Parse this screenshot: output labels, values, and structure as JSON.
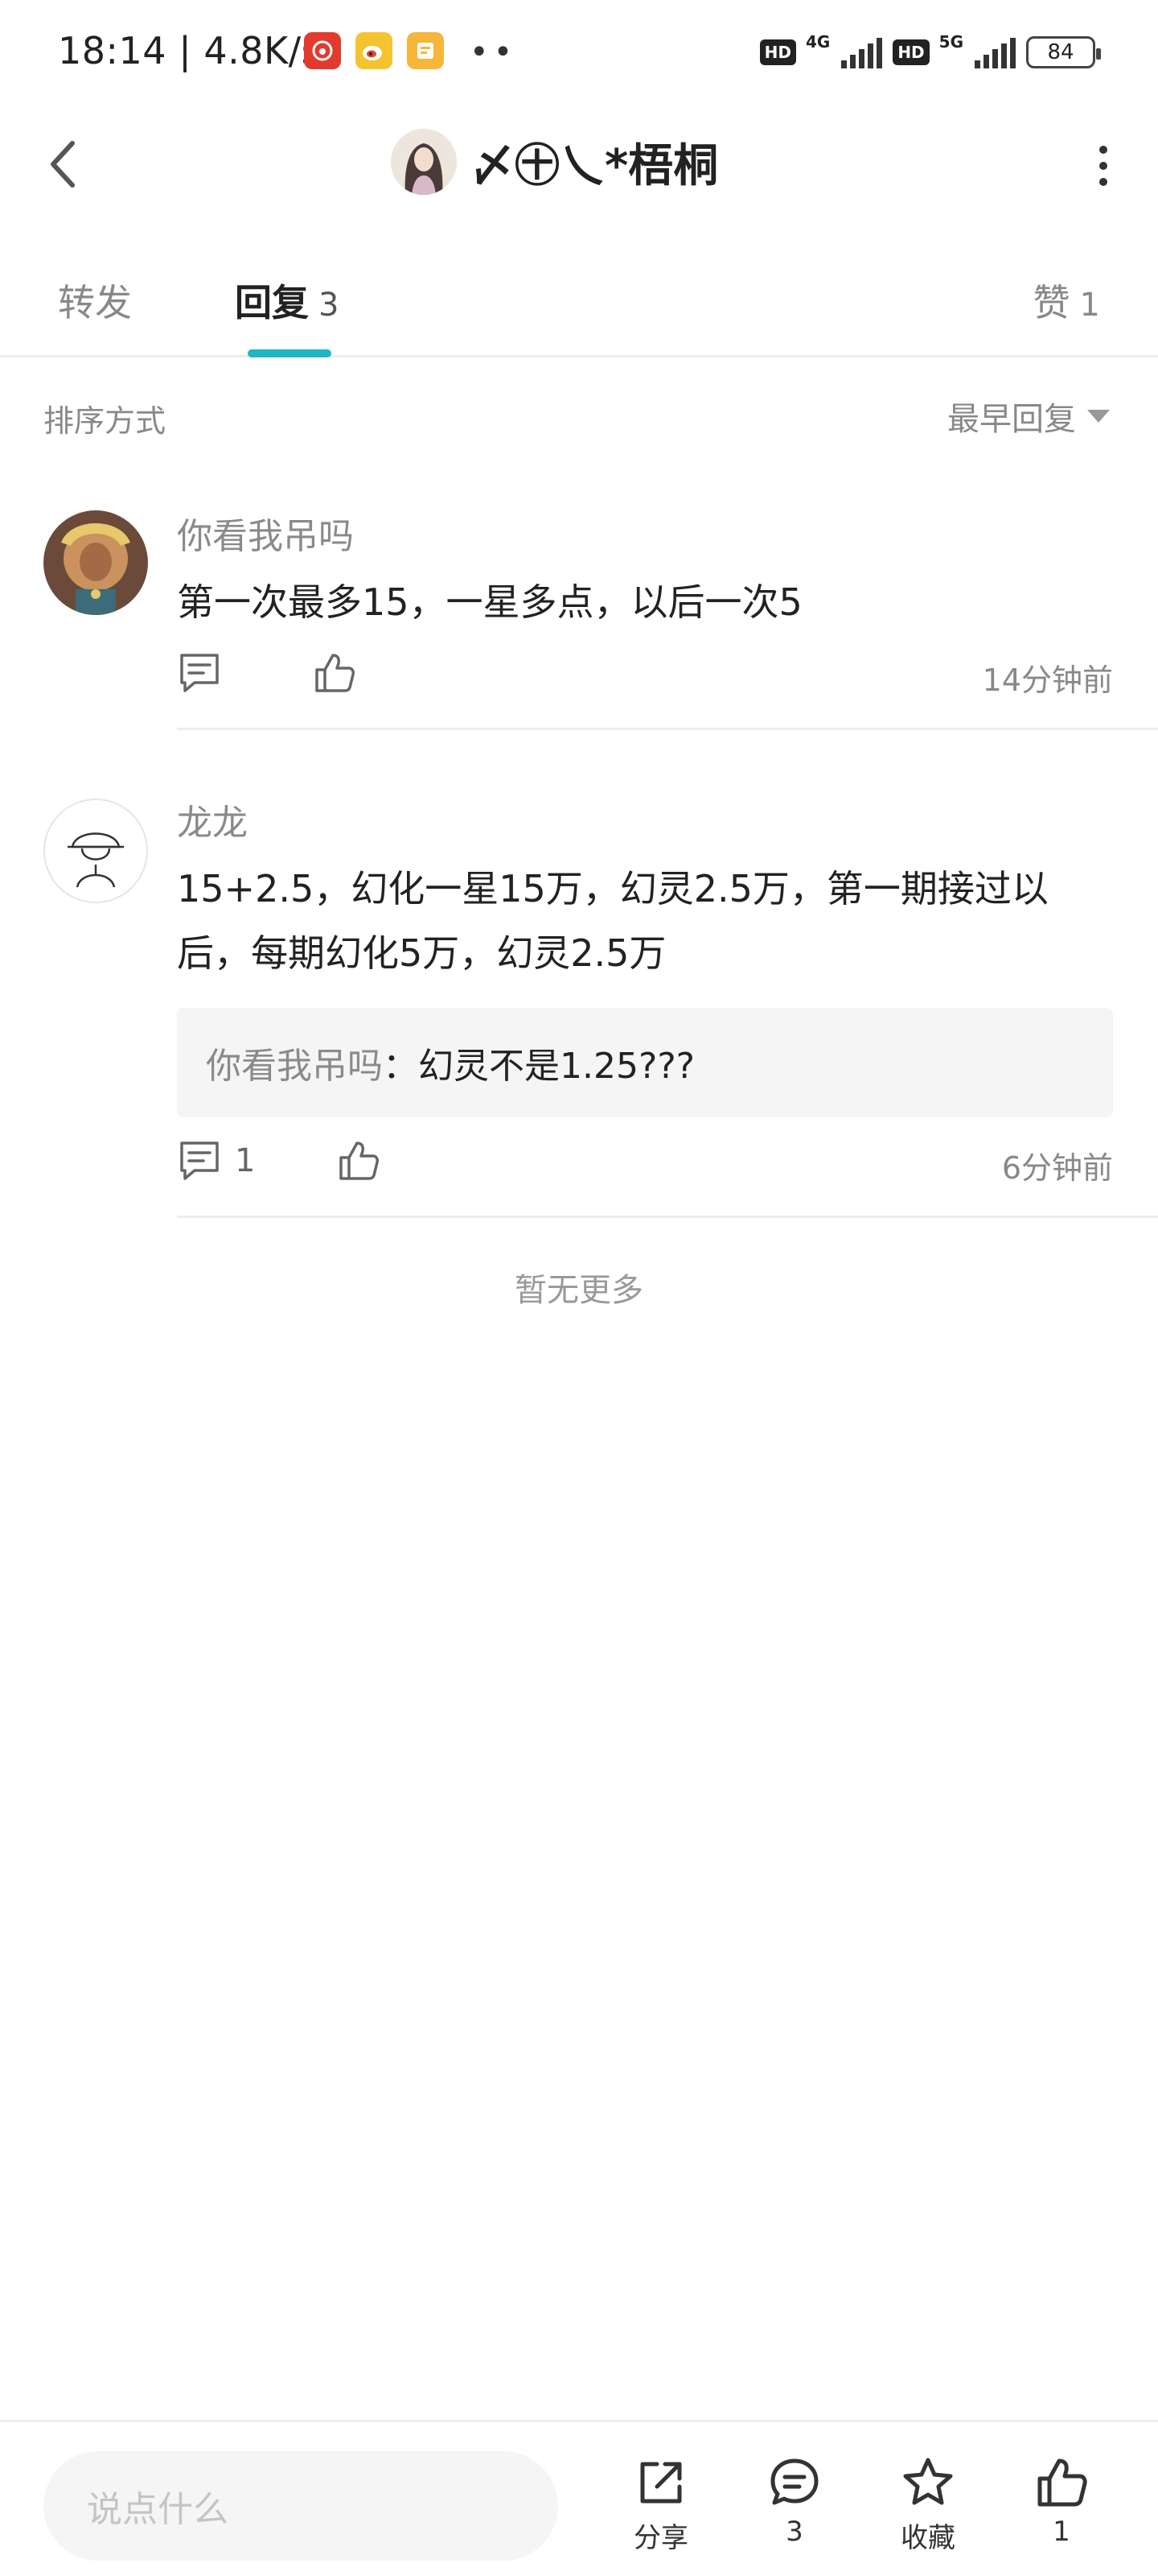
{
  "status_bar": {
    "time": "18:14",
    "separator": "|",
    "speed": "4.8K/s",
    "dots": "••",
    "hd_label": "HD",
    "net_4g": "4G",
    "net_5g": "5G",
    "battery": "84",
    "app_icons": [
      "netease-music-icon",
      "weibo-icon",
      "notes-app-icon"
    ]
  },
  "header": {
    "title": "〆㊉乀*梧桐"
  },
  "tabs": {
    "forward": "转发",
    "reply": "回复",
    "reply_count": "3",
    "like": "赞",
    "like_count": "1"
  },
  "sort": {
    "label": "排序方式",
    "value": "最早回复"
  },
  "comments": [
    {
      "name": "你看我吊吗",
      "text": "第一次最多15，一星多点，以后一次5",
      "reply_count": "",
      "time": "14分钟前"
    },
    {
      "name": "龙龙",
      "text": "15+2.5，幻化一星15万，幻灵2.5万，第一期接过以后，每期幻化5万，幻灵2.5万",
      "quote_name": "你看我吊吗",
      "quote_sep": "：",
      "quote_text": "幻灵不是1.25???",
      "reply_count": "1",
      "time": "6分钟前"
    }
  ],
  "no_more": "暂无更多",
  "bottom_bar": {
    "input_placeholder": "说点什么",
    "share_label": "分享",
    "comment_count": "3",
    "favorite_label": "收藏",
    "like_count": "1"
  },
  "colors": {
    "accent": "#1fb6c5",
    "text_primary": "#222222",
    "text_secondary": "#888888"
  }
}
